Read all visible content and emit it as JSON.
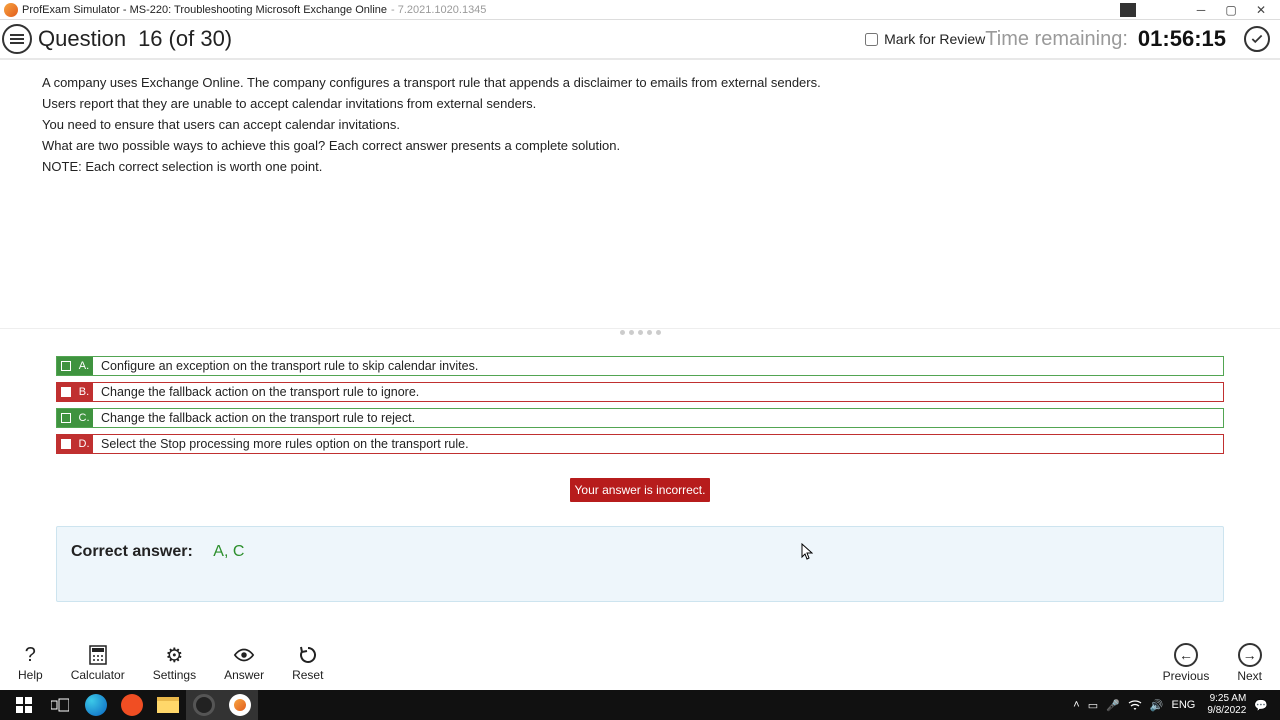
{
  "window": {
    "app_title": "ProfExam Simulator - MS-220: Troubleshooting Microsoft Exchange Online",
    "app_version": "- 7.2021.1020.1345"
  },
  "header": {
    "question_label": "Question",
    "question_number": "16",
    "question_total": "(of 30)",
    "mark_for_review": "Mark for Review",
    "time_remaining_label": "Time remaining:",
    "time_remaining_value": "01:56:15"
  },
  "question": {
    "lines": [
      "A company uses Exchange Online. The company configures a transport rule that appends a disclaimer to emails from external senders.",
      "Users report that they are unable to accept calendar invitations from external senders.",
      "You need to ensure that users can accept calendar invitations.",
      "What are two possible ways to achieve this goal? Each correct answer presents a complete solution.",
      "NOTE: Each correct selection is worth one point."
    ]
  },
  "options": [
    {
      "letter": "A.",
      "text": "Configure an exception on the transport rule to skip calendar invites.",
      "state": "green",
      "checked": false
    },
    {
      "letter": "B.",
      "text": "Change the fallback action on the transport rule to ignore.",
      "state": "red",
      "checked": true
    },
    {
      "letter": "C.",
      "text": "Change the fallback action on the transport rule to reject.",
      "state": "green",
      "checked": false
    },
    {
      "letter": "D.",
      "text": "Select the Stop processing more rules option on the transport rule.",
      "state": "red",
      "checked": true
    }
  ],
  "feedback": "Your answer is incorrect.",
  "correct": {
    "label": "Correct answer:",
    "value": "A, C"
  },
  "controls": {
    "help": "Help",
    "calculator": "Calculator",
    "settings": "Settings",
    "answer": "Answer",
    "reset": "Reset",
    "previous": "Previous",
    "next": "Next"
  },
  "taskbar": {
    "lang": "ENG",
    "time": "9:25 AM",
    "date": "9/8/2022"
  }
}
